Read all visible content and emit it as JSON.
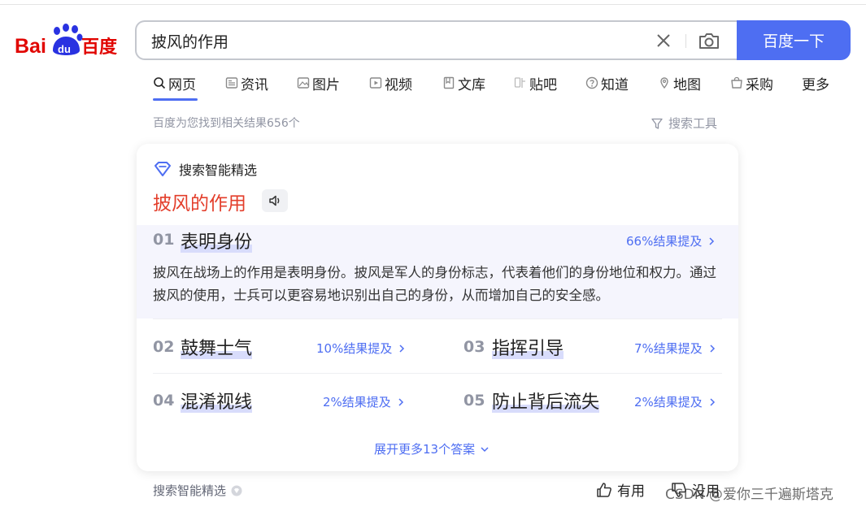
{
  "logo": {
    "text_left": "Bai",
    "text_paw": "du",
    "text_right": "百度"
  },
  "search": {
    "query": "披风的作用",
    "button_label": "百度一下"
  },
  "tabs": [
    {
      "label": "网页",
      "icon": "search-icon",
      "active": true
    },
    {
      "label": "资讯",
      "icon": "news-icon"
    },
    {
      "label": "图片",
      "icon": "image-icon"
    },
    {
      "label": "视频",
      "icon": "video-icon"
    },
    {
      "label": "文库",
      "icon": "doc-icon"
    },
    {
      "label": "贴吧",
      "icon": "tieba-icon"
    },
    {
      "label": "知道",
      "icon": "question-icon"
    },
    {
      "label": "地图",
      "icon": "map-icon"
    },
    {
      "label": "采购",
      "icon": "purchase-icon"
    },
    {
      "label": "更多"
    }
  ],
  "results": {
    "count_text": "百度为您找到相关结果656个",
    "tools_label": "搜索工具"
  },
  "card": {
    "tag": "搜索智能精选",
    "title": "披风的作用",
    "items": [
      {
        "num": "01",
        "title": "表明身份",
        "link": "66%结果提及",
        "desc": "披风在战场上的作用是表明身份。披风是军人的身份标志，代表着他们的身份地位和权力。通过披风的使用，士兵可以更容易地识别出自己的身份，从而增加自己的安全感。"
      },
      {
        "num": "02",
        "title": "鼓舞士气",
        "link": "10%结果提及"
      },
      {
        "num": "03",
        "title": "指挥引导",
        "link": "7%结果提及"
      },
      {
        "num": "04",
        "title": "混淆视线",
        "link": "2%结果提及"
      },
      {
        "num": "05",
        "title": "防止背后流失",
        "link": "2%结果提及"
      }
    ],
    "expand_label": "展开更多13个答案"
  },
  "footer": {
    "tag": "搜索智能精选",
    "useful": "有用",
    "useless": "没用"
  },
  "watermark": "CSDN @爱你三千遍斯塔克",
  "colors": {
    "accent": "#4e6ef2",
    "title_red": "#e33e2b",
    "logo_red": "#e10602",
    "logo_blue": "#2932e1"
  }
}
